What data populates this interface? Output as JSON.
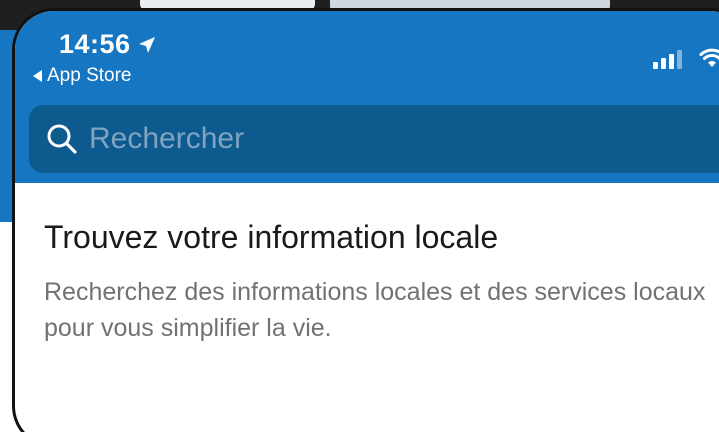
{
  "status_bar": {
    "time": "14:56",
    "location_icon": "location-arrow-icon",
    "back_label": "App Store",
    "signal_icon": "cellular-signal-icon",
    "wifi_icon": "wifi-icon"
  },
  "search": {
    "placeholder": "Rechercher",
    "icon": "search-icon"
  },
  "main": {
    "title": "Trouvez votre information locale",
    "description": "Recherchez des informations locales et des services locaux pour vous simplifier la vie."
  },
  "colors": {
    "header_blue": "#1676c2",
    "search_bg": "#0d5a8e",
    "title_text": "#1a1a1a",
    "body_text": "#727272"
  }
}
